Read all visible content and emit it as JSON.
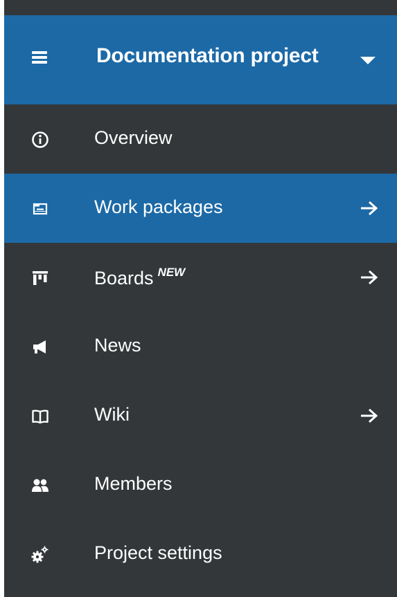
{
  "header": {
    "project_title": "Documentation project",
    "menu_icon": "hamburger-icon",
    "dropdown_icon": "caret-down-icon"
  },
  "colors": {
    "header_bg": "#1c69a6",
    "active_bg": "#1c69a6",
    "sidebar_bg": "#333739",
    "text": "#ffffff"
  },
  "menu": {
    "items": [
      {
        "label": "Overview",
        "icon": "info-icon",
        "active": false,
        "has_arrow": false
      },
      {
        "label": "Work packages",
        "icon": "work-packages-icon",
        "active": true,
        "has_arrow": true
      },
      {
        "label": "Boards",
        "badge": "NEW",
        "icon": "boards-icon",
        "active": false,
        "has_arrow": true
      },
      {
        "label": "News",
        "icon": "news-megaphone-icon",
        "active": false,
        "has_arrow": false
      },
      {
        "label": "Wiki",
        "icon": "wiki-book-icon",
        "active": false,
        "has_arrow": true
      },
      {
        "label": "Members",
        "icon": "members-icon",
        "active": false,
        "has_arrow": false
      },
      {
        "label": "Project settings",
        "icon": "settings-gears-icon",
        "active": false,
        "has_arrow": false
      }
    ]
  }
}
